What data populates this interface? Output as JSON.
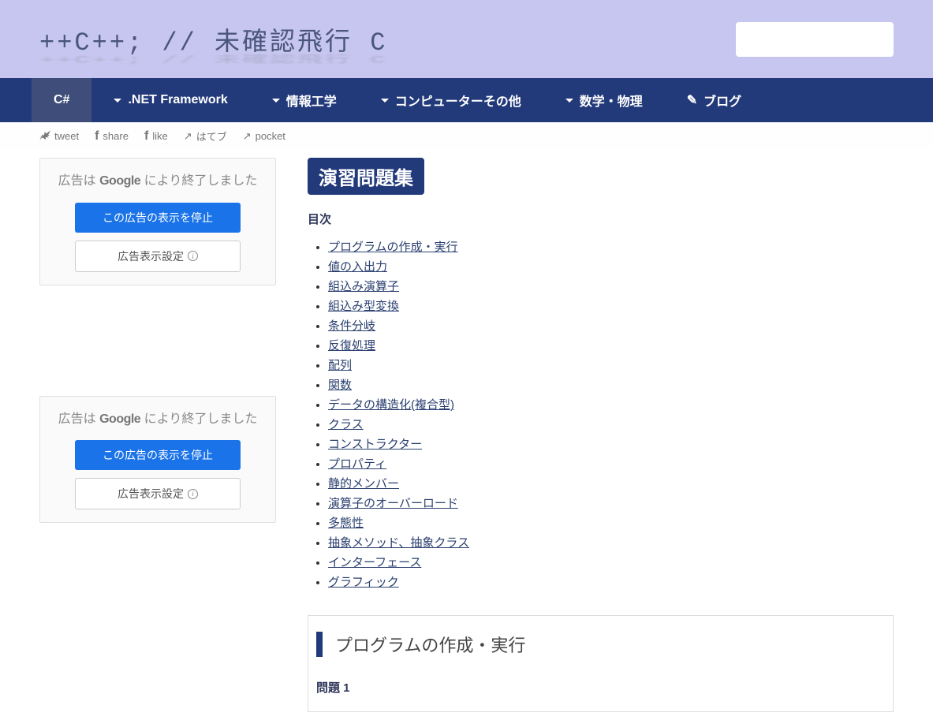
{
  "header": {
    "site_title": "++C++; // 未確認飛行 C"
  },
  "nav": {
    "items": [
      {
        "label": "C#",
        "dropdown": false,
        "active": true
      },
      {
        "label": ".NET Framework",
        "dropdown": true
      },
      {
        "label": "情報工学",
        "dropdown": true
      },
      {
        "label": "コンピューターその他",
        "dropdown": true
      },
      {
        "label": "数学・物理",
        "dropdown": true
      },
      {
        "label": "ブログ",
        "dropdown": false,
        "icon": "pen"
      }
    ]
  },
  "share": {
    "tweet": "tweet",
    "share": "share",
    "like": "like",
    "hateb": "はてブ",
    "pocket": "pocket"
  },
  "ads": {
    "text_prefix": "広告は ",
    "google": "Google",
    "text_suffix": " により終了しました",
    "stop_button": "この広告の表示を停止",
    "settings_button": "広告表示設定"
  },
  "main": {
    "title": "演習問題集",
    "toc_heading": "目次",
    "toc_items": [
      "プログラムの作成・実行",
      "値の入出力",
      "組込み演算子",
      "組込み型変換",
      "条件分岐",
      "反復処理",
      "配列",
      "関数",
      "データの構造化(複合型)",
      "クラス",
      "コンストラクター",
      "プロパティ",
      "静的メンバー",
      "演算子のオーバーロード",
      "多態性",
      "抽象メソッド、抽象クラス",
      "インターフェース",
      "グラフィック"
    ],
    "section_heading": "プログラムの作成・実行",
    "question_heading": "問題 1"
  }
}
